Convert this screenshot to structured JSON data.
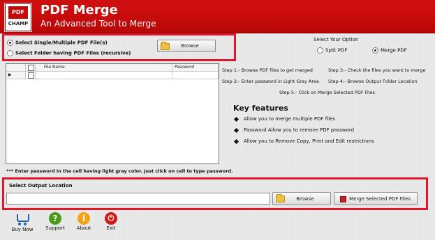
{
  "header": {
    "logo_top": "PDF",
    "logo_bottom": "CHAMP",
    "title": "PDF Merge",
    "subtitle": "An Advanced Tool to Merge"
  },
  "source": {
    "option_single": "Select Single/Multiple PDF File(s)",
    "option_folder": "Select Folder having PDF Files (recursive)",
    "browse_label": "Browse"
  },
  "mode": {
    "title": "Select Your Option",
    "split_label": "Split PDF",
    "merge_label": "Merge PDF"
  },
  "grid": {
    "columns": [
      "File Name",
      "Password"
    ]
  },
  "steps": {
    "step1": "Step 1:- Browse PDF files to get merged",
    "step2": "Step 2:- Enter password in Light Gray Area",
    "step3": "Step 3:- Check the files you want to merge",
    "step4": "Step 4:- Browse Output Folder Location",
    "step5": "Step 5:- Click on Merge Selected PDF Files"
  },
  "features": {
    "title": "Key features",
    "items": [
      "Allow you to merge multiple PDF files",
      "Password Allow you to remove PDF password",
      "Allow you to Remove Copy, Print and Edit restrictions"
    ]
  },
  "password_note": "*** Enter password in the cell having light gray color. Just click on cell to type password.",
  "output": {
    "label": "Select  Output Location",
    "path_value": "",
    "browse_label": "Browse",
    "merge_label": "Merge Selected PDF Files"
  },
  "toolbar": {
    "buy_now": "Buy Now",
    "support": "Support",
    "about": "About",
    "exit": "Exit"
  }
}
